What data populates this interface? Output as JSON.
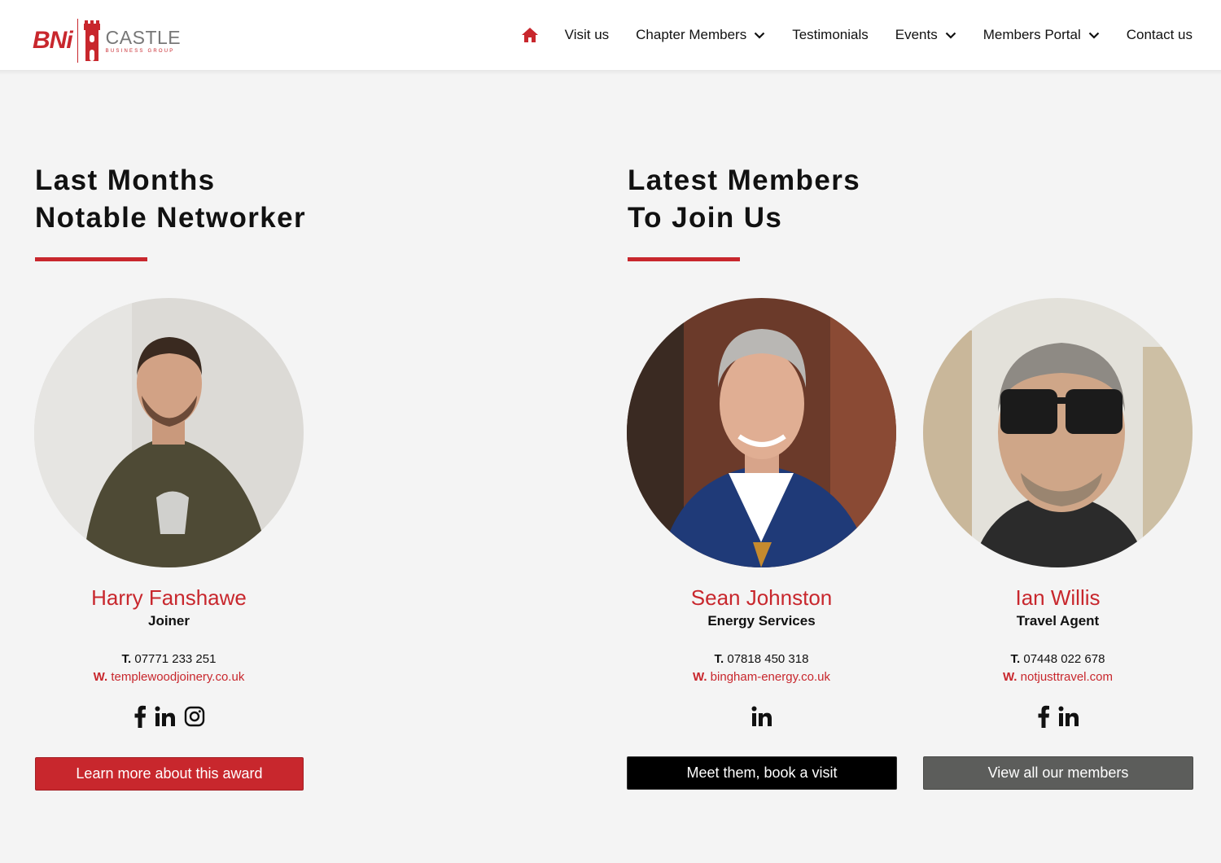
{
  "brand": {
    "logo_bni": "BNi",
    "logo_name": "CASTLE",
    "logo_sub": "BUSINESS GROUP",
    "accent_color": "#c8272d"
  },
  "nav": {
    "home_icon": "home-icon",
    "items": [
      {
        "label": "Visit us",
        "dropdown": false
      },
      {
        "label": "Chapter Members",
        "dropdown": true
      },
      {
        "label": "Testimonials",
        "dropdown": false
      },
      {
        "label": "Events",
        "dropdown": true
      },
      {
        "label": "Members Portal",
        "dropdown": true
      },
      {
        "label": "Contact us",
        "dropdown": false
      }
    ]
  },
  "notable": {
    "heading_line1": "Last Months",
    "heading_line2": "Notable Networker",
    "member": {
      "name": "Harry Fanshawe",
      "role": "Joiner",
      "phone_label": "T.",
      "phone": "07771 233 251",
      "web_label": "W.",
      "web": "templewoodjoinery.co.uk",
      "socials": [
        "facebook-icon",
        "linkedin-icon",
        "instagram-icon"
      ]
    },
    "button_label": "Learn more about this award"
  },
  "latest": {
    "heading_line1": "Latest Members",
    "heading_line2": "To Join Us",
    "members": [
      {
        "name": "Sean Johnston",
        "role": "Energy Services",
        "phone_label": "T.",
        "phone": "07818 450 318",
        "web_label": "W.",
        "web": "bingham-energy.co.uk",
        "socials": [
          "linkedin-icon"
        ]
      },
      {
        "name": "Ian Willis",
        "role": "Travel Agent",
        "phone_label": "T.",
        "phone": "07448 022 678",
        "web_label": "W.",
        "web": "notjusttravel.com",
        "socials": [
          "facebook-icon",
          "linkedin-icon"
        ]
      }
    ],
    "book_button_label": "Meet them, book a visit",
    "view_button_label": "View all our members"
  }
}
